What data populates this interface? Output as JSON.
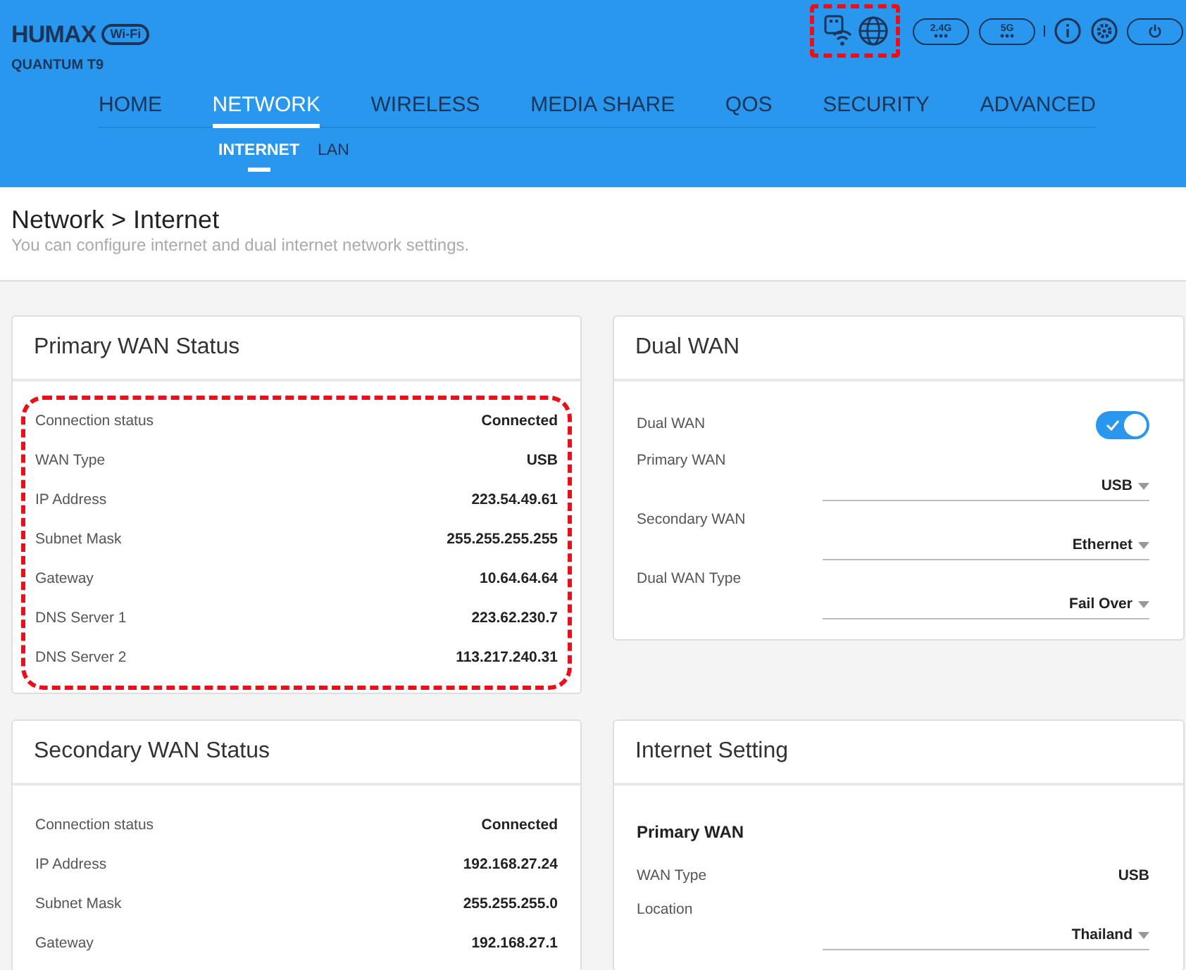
{
  "header": {
    "logo": "HUMAX",
    "logo_badge": "Wi-Fi",
    "model": "QUANTUM T9",
    "status_icons_highlighted": true,
    "band_buttons": [
      "2.4G",
      "5G"
    ]
  },
  "nav": [
    {
      "label": "HOME",
      "selected": false
    },
    {
      "label": "NETWORK",
      "selected": true
    },
    {
      "label": "WIRELESS",
      "selected": false
    },
    {
      "label": "MEDIA SHARE",
      "selected": false
    },
    {
      "label": "QOS",
      "selected": false
    },
    {
      "label": "SECURITY",
      "selected": false
    },
    {
      "label": "ADVANCED",
      "selected": false
    }
  ],
  "subnav": [
    {
      "label": "INTERNET",
      "selected": true
    },
    {
      "label": "LAN",
      "selected": false
    }
  ],
  "page": {
    "title": "Network > Internet",
    "subtitle": "You can configure internet and dual internet network settings."
  },
  "cards": [
    {
      "title": "Primary WAN Status",
      "highlighted": true,
      "rows": [
        {
          "kind": "info",
          "label": "Connection status",
          "value": "Connected"
        },
        {
          "kind": "info",
          "label": "WAN Type",
          "value": "USB"
        },
        {
          "kind": "info",
          "label": "IP Address",
          "value": "223.54.49.61"
        },
        {
          "kind": "info",
          "label": "Subnet Mask",
          "value": "255.255.255.255"
        },
        {
          "kind": "info",
          "label": "Gateway",
          "value": "10.64.64.64"
        },
        {
          "kind": "info",
          "label": "DNS Server 1",
          "value": "223.62.230.7"
        },
        {
          "kind": "info",
          "label": "DNS Server 2",
          "value": "113.217.240.31"
        }
      ]
    },
    {
      "title": "Dual WAN",
      "highlighted": false,
      "rows": [
        {
          "kind": "toggle",
          "label": "Dual WAN",
          "on": true
        },
        {
          "kind": "select",
          "label": "Primary WAN",
          "value": "USB"
        },
        {
          "kind": "select",
          "label": "Secondary WAN",
          "value": "Ethernet"
        },
        {
          "kind": "select",
          "label": "Dual WAN Type",
          "value": "Fail Over"
        }
      ]
    },
    {
      "title": "Secondary WAN Status",
      "highlighted": false,
      "rows": [
        {
          "kind": "info",
          "label": "Connection status",
          "value": "Connected"
        },
        {
          "kind": "info",
          "label": "IP Address",
          "value": "192.168.27.24"
        },
        {
          "kind": "info",
          "label": "Subnet Mask",
          "value": "255.255.255.0"
        },
        {
          "kind": "info",
          "label": "Gateway",
          "value": "192.168.27.1"
        }
      ]
    },
    {
      "title": "Internet Setting",
      "highlighted": false,
      "rows": [
        {
          "kind": "heading",
          "label": "Primary WAN"
        },
        {
          "kind": "info",
          "label": "WAN Type",
          "value": "USB"
        },
        {
          "kind": "select",
          "label": "Location",
          "value": "Thailand"
        }
      ]
    }
  ]
}
